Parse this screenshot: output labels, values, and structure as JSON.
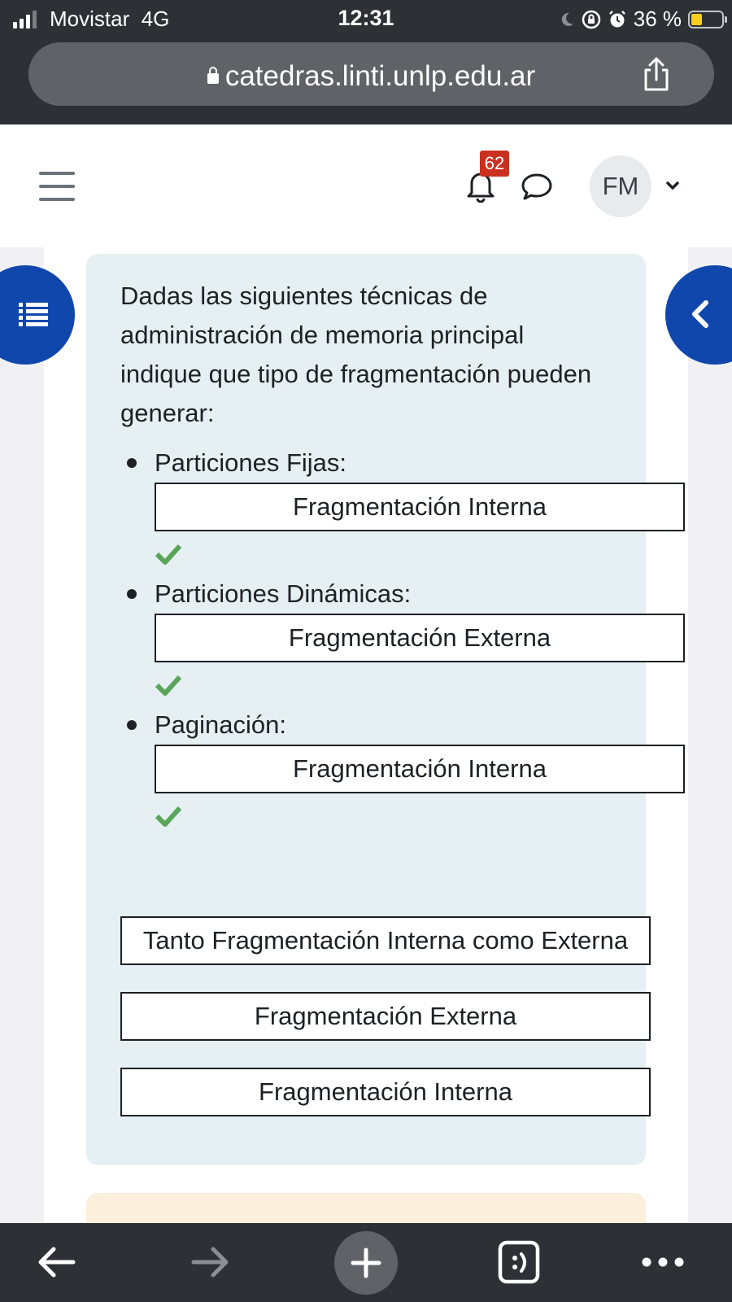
{
  "status_bar": {
    "carrier": "Movistar",
    "network": "4G",
    "time": "12:31",
    "battery_percent": "36 %",
    "battery_level": 0.36
  },
  "browser": {
    "url": "catedras.linti.unlp.edu.ar"
  },
  "header": {
    "notification_count": "62",
    "user_initials": "FM"
  },
  "question": {
    "text": "Dadas las siguientes técnicas de administración de memoria principal indique que tipo de fragmentación pueden generar:",
    "items": [
      {
        "label": "Particiones Fijas:",
        "answer": "Fragmentación Interna",
        "correct": true
      },
      {
        "label": "Particiones Dinámicas:",
        "answer": "Fragmentación Externa",
        "correct": true
      },
      {
        "label": "Paginación:",
        "answer": "Fragmentación Interna",
        "correct": true
      }
    ],
    "options": [
      "Tanto Fragmentación Interna como Externa",
      "Fragmentación Externa",
      "Fragmentación Interna"
    ]
  },
  "colors": {
    "primary": "#0f47ad",
    "question_bg": "#e6f0f3",
    "correct": "#5aa55a",
    "badge": "#ca3120",
    "browser_chrome": "#2d3135"
  }
}
